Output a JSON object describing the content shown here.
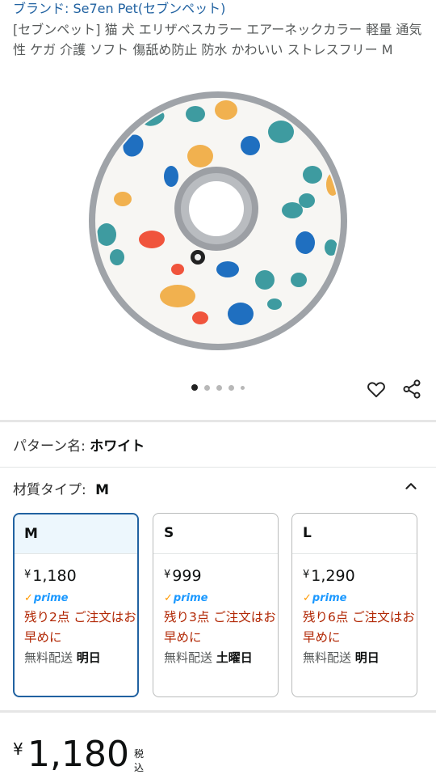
{
  "product": {
    "brand": "ブランド: Se7en Pet(セブンペット)",
    "title": "[セブンペット] 猫 犬 エリザベスカラー エアーネックカラー 軽量 通気性 ケガ 介護 ソフト 傷舐め防止 防水 かわいい ストレスフリー M"
  },
  "gallery": {
    "image_count": 5,
    "active_index": 0
  },
  "actions": {
    "wishlist_icon": "heart-icon",
    "share_icon": "share-icon"
  },
  "pattern": {
    "label": "パターン名: ",
    "value": "ホワイト"
  },
  "material": {
    "label": "材質タイプ: ",
    "value": "M"
  },
  "variants": [
    {
      "size": "M",
      "yen": "¥",
      "price": "1,180",
      "prime": "prime",
      "stock": "残り2点 ご注文はお早めに",
      "ship_label": "無料配送 ",
      "ship_day": "明日",
      "selected": true
    },
    {
      "size": "S",
      "yen": "¥",
      "price": "999",
      "prime": "prime",
      "stock": "残り3点 ご注文はお早めに",
      "ship_label": "無料配送 ",
      "ship_day": "土曜日",
      "selected": false
    },
    {
      "size": "L",
      "yen": "¥",
      "price": "1,290",
      "prime": "prime",
      "stock": "残り6点 ご注文はお早めに",
      "ship_label": "無料配送 ",
      "ship_day": "明日",
      "selected": false
    }
  ],
  "summary": {
    "yen": "¥",
    "price": "1,180",
    "tax": "税込"
  },
  "colors": {
    "link_blue": "#2162a1",
    "stock_red": "#b12704",
    "prime_blue": "#1a98ff",
    "selected_border": "#2162a1",
    "selected_bg": "#edf7fd"
  }
}
